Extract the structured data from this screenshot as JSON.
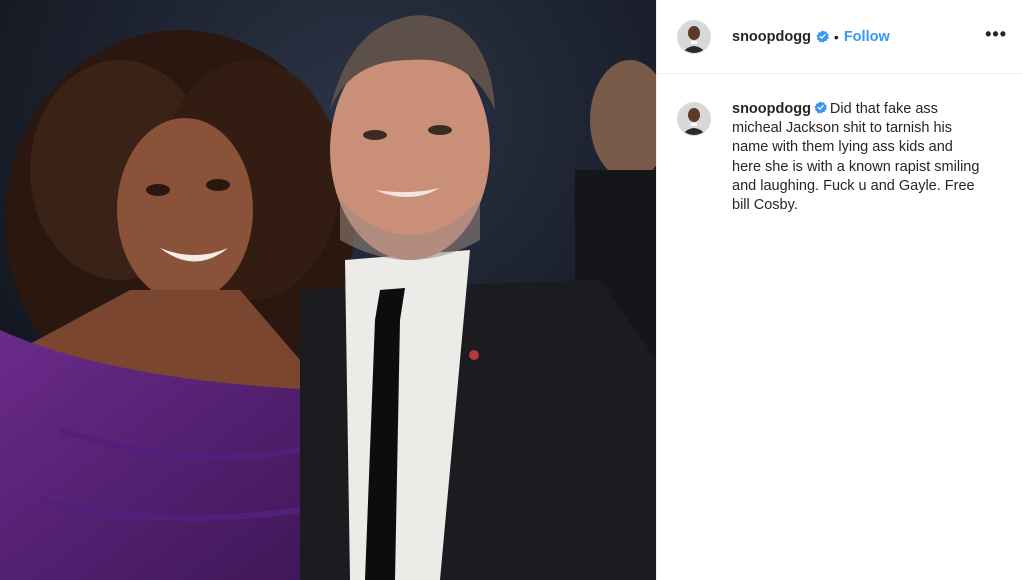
{
  "header": {
    "username": "snoopdogg",
    "separator": "•",
    "follow_label": "Follow",
    "more_label": "•••"
  },
  "caption": {
    "username": "snoopdogg",
    "text": "Did that fake ass micheal Jackson shit to tarnish his name with them lying ass kids and here she is with a known rapist smiling and laughing. Fuck u and Gayle. Free bill Cosby."
  },
  "photo": {
    "subject": "two people posing at an event"
  },
  "colors": {
    "follow_blue": "#3897f0",
    "verified_blue": "#3897f0",
    "divider": "#efefef",
    "text": "#262626"
  },
  "icons": {
    "verified": "verified-badge-icon",
    "more": "more-options-icon"
  }
}
